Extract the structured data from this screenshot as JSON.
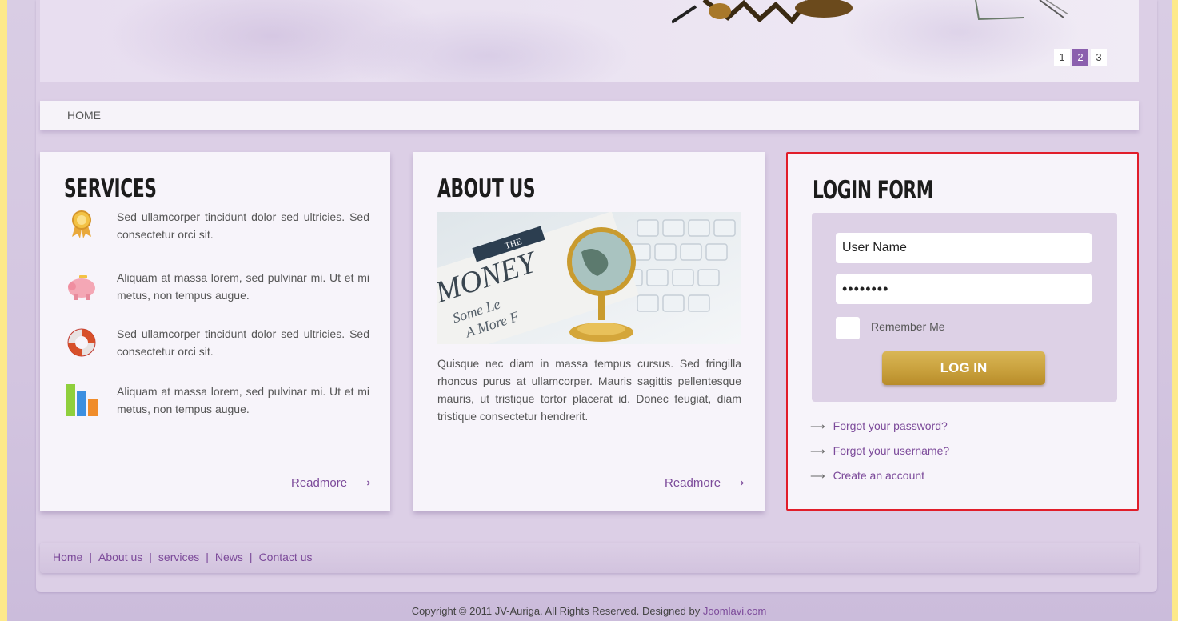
{
  "banner": {
    "pager": [
      "1",
      "2",
      "3"
    ],
    "pager_active": "2"
  },
  "nav": {
    "home": "HOME"
  },
  "services": {
    "title": "SERVICES",
    "items": [
      {
        "icon": "award-ribbon-icon",
        "text": "Sed ullamcorper tincidunt dolor sed ultricies. Sed consectetur orci sit."
      },
      {
        "icon": "piggy-bank-icon",
        "text": "Aliquam at massa lorem, sed pulvinar mi. Ut et mi metus, non tempus augue."
      },
      {
        "icon": "lifebuoy-icon",
        "text": "Sed ullamcorper tincidunt dolor sed ultricies. Sed consectetur orci sit."
      },
      {
        "icon": "bar-chart-icon",
        "text": "Aliquam at massa lorem, sed pulvinar mi. Ut et mi metus, non tempus augue."
      }
    ],
    "readmore": "Readmore"
  },
  "about": {
    "title": "ABOUT US",
    "photo_words": {
      "the": "THE",
      "money": "MONEY",
      "line2": "Some Le",
      "line3": "A More F"
    },
    "text": "Quisque nec diam in massa tempus cursus. Sed fringilla rhoncus purus at ullamcorper. Mauris sagittis pellentesque mauris, ut tristique tortor placerat id. Donec feugiat, diam tristique consectetur hendrerit.",
    "readmore": "Readmore"
  },
  "login": {
    "title": "LOGIN FORM",
    "username_value": "User Name",
    "password_value": "password",
    "remember_label": "Remember Me",
    "button_label": "LOG IN",
    "links": [
      "Forgot your password?",
      "Forgot your username?",
      "Create an account"
    ]
  },
  "footer": {
    "links": [
      "Home",
      "About us",
      "services",
      "News",
      "Contact us"
    ],
    "copyright_text": "Copyright © 2011 JV-Auriga. All Rights Reserved. Designed by ",
    "copyright_link": "Joomlavi.com"
  },
  "colors": {
    "background": "#fde98a",
    "accent_purple": "#7c4a9a",
    "active_page": "#8b5fae",
    "button_gold": "#c9a13d",
    "highlight_border": "#e11d2a"
  }
}
